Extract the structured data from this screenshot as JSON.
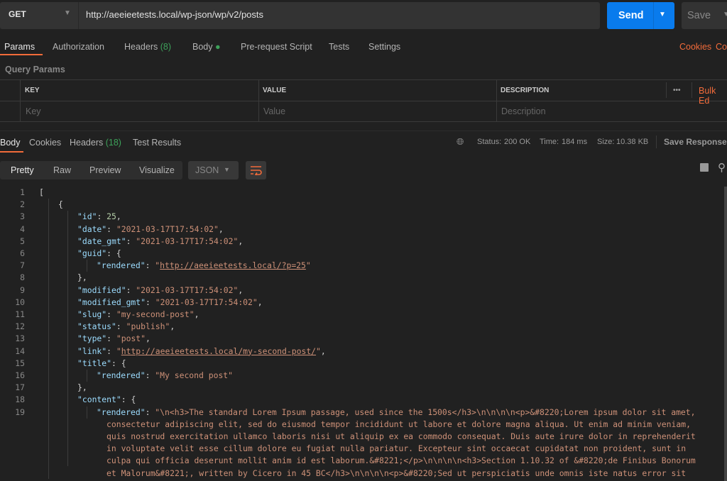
{
  "request": {
    "method": "GET",
    "url": "http://aeeieetests.local/wp-json/wp/v2/posts",
    "send_label": "Send",
    "save_label": "Save"
  },
  "req_tabs": {
    "params": "Params",
    "authorization": "Authorization",
    "headers": "Headers",
    "headers_count": "(8)",
    "body": "Body",
    "prerequest": "Pre-request Script",
    "tests": "Tests",
    "settings": "Settings",
    "cookies": "Cookies",
    "code": "Co"
  },
  "query_params": {
    "title": "Query Params",
    "headers": {
      "key": "KEY",
      "value": "VALUE",
      "description": "DESCRIPTION",
      "more": "•••",
      "bulk_edit": "Bulk Ed"
    },
    "placeholders": {
      "key": "Key",
      "value": "Value",
      "description": "Description"
    }
  },
  "response": {
    "tabs": {
      "body": "Body",
      "cookies": "Cookies",
      "headers": "Headers",
      "headers_count": "(18)",
      "test_results": "Test Results"
    },
    "status_label": "Status:",
    "status": "200 OK",
    "time_label": "Time:",
    "time": "184 ms",
    "size_label": "Size:",
    "size": "10.38 KB",
    "save_response": "Save Response",
    "views": {
      "pretty": "Pretty",
      "raw": "Raw",
      "preview": "Preview",
      "visualize": "Visualize",
      "format": "JSON"
    },
    "colors": {
      "accent": "#f26b3a",
      "send": "#097bed",
      "ok": "#3da15a"
    }
  },
  "code_lines": [
    {
      "n": "1",
      "i": 0,
      "t": [
        [
          "p",
          "["
        ]
      ]
    },
    {
      "n": "2",
      "i": 1,
      "t": [
        [
          "p",
          "{"
        ]
      ]
    },
    {
      "n": "3",
      "i": 2,
      "t": [
        [
          "k",
          "\"id\""
        ],
        [
          "p",
          ": "
        ],
        [
          "n",
          "25"
        ],
        [
          "p",
          ","
        ]
      ]
    },
    {
      "n": "4",
      "i": 2,
      "t": [
        [
          "k",
          "\"date\""
        ],
        [
          "p",
          ": "
        ],
        [
          "s",
          "\"2021-03-17T17:54:02\""
        ],
        [
          "p",
          ","
        ]
      ]
    },
    {
      "n": "5",
      "i": 2,
      "t": [
        [
          "k",
          "\"date_gmt\""
        ],
        [
          "p",
          ": "
        ],
        [
          "s",
          "\"2021-03-17T17:54:02\""
        ],
        [
          "p",
          ","
        ]
      ]
    },
    {
      "n": "6",
      "i": 2,
      "t": [
        [
          "k",
          "\"guid\""
        ],
        [
          "p",
          ": {"
        ]
      ]
    },
    {
      "n": "7",
      "i": 3,
      "t": [
        [
          "k",
          "\"rendered\""
        ],
        [
          "p",
          ": "
        ],
        [
          "s",
          "\""
        ],
        [
          "l",
          "http://aeeieetests.local/?p=25"
        ],
        [
          "s",
          "\""
        ]
      ]
    },
    {
      "n": "8",
      "i": 2,
      "t": [
        [
          "p",
          "},"
        ]
      ]
    },
    {
      "n": "9",
      "i": 2,
      "t": [
        [
          "k",
          "\"modified\""
        ],
        [
          "p",
          ": "
        ],
        [
          "s",
          "\"2021-03-17T17:54:02\""
        ],
        [
          "p",
          ","
        ]
      ]
    },
    {
      "n": "10",
      "i": 2,
      "t": [
        [
          "k",
          "\"modified_gmt\""
        ],
        [
          "p",
          ": "
        ],
        [
          "s",
          "\"2021-03-17T17:54:02\""
        ],
        [
          "p",
          ","
        ]
      ]
    },
    {
      "n": "11",
      "i": 2,
      "t": [
        [
          "k",
          "\"slug\""
        ],
        [
          "p",
          ": "
        ],
        [
          "s",
          "\"my-second-post\""
        ],
        [
          "p",
          ","
        ]
      ]
    },
    {
      "n": "12",
      "i": 2,
      "t": [
        [
          "k",
          "\"status\""
        ],
        [
          "p",
          ": "
        ],
        [
          "s",
          "\"publish\""
        ],
        [
          "p",
          ","
        ]
      ]
    },
    {
      "n": "13",
      "i": 2,
      "t": [
        [
          "k",
          "\"type\""
        ],
        [
          "p",
          ": "
        ],
        [
          "s",
          "\"post\""
        ],
        [
          "p",
          ","
        ]
      ]
    },
    {
      "n": "14",
      "i": 2,
      "t": [
        [
          "k",
          "\"link\""
        ],
        [
          "p",
          ": "
        ],
        [
          "s",
          "\""
        ],
        [
          "l",
          "http://aeeieetests.local/my-second-post/"
        ],
        [
          "s",
          "\""
        ],
        [
          "p",
          ","
        ]
      ]
    },
    {
      "n": "15",
      "i": 2,
      "t": [
        [
          "k",
          "\"title\""
        ],
        [
          "p",
          ": {"
        ]
      ]
    },
    {
      "n": "16",
      "i": 3,
      "t": [
        [
          "k",
          "\"rendered\""
        ],
        [
          "p",
          ": "
        ],
        [
          "s",
          "\"My second post\""
        ]
      ]
    },
    {
      "n": "17",
      "i": 2,
      "t": [
        [
          "p",
          "},"
        ]
      ]
    },
    {
      "n": "18",
      "i": 2,
      "t": [
        [
          "k",
          "\"content\""
        ],
        [
          "p",
          ": {"
        ]
      ]
    },
    {
      "n": "19",
      "i": 3,
      "t": [
        [
          "k",
          "\"rendered\""
        ],
        [
          "p",
          ": "
        ],
        [
          "s",
          "\"\\n<h3>The standard Lorem Ipsum passage, used since the 1500s</h3>\\n\\n\\n\\n<p>&#8220;Lorem ipsum dolor sit amet,"
        ]
      ]
    },
    {
      "n": "",
      "i": 4,
      "t": [
        [
          "s",
          "consectetur adipiscing elit, sed do eiusmod tempor incididunt ut labore et dolore magna aliqua. Ut enim ad minim veniam,"
        ]
      ]
    },
    {
      "n": "",
      "i": 4,
      "t": [
        [
          "s",
          "quis nostrud exercitation ullamco laboris nisi ut aliquip ex ea commodo consequat. Duis aute irure dolor in reprehenderit"
        ]
      ]
    },
    {
      "n": "",
      "i": 4,
      "t": [
        [
          "s",
          "in voluptate velit esse cillum dolore eu fugiat nulla pariatur. Excepteur sint occaecat cupidatat non proident, sunt in"
        ]
      ]
    },
    {
      "n": "",
      "i": 4,
      "t": [
        [
          "s",
          "culpa qui officia deserunt mollit anim id est laborum.&#8221;</p>\\n\\n\\n\\n<h3>Section 1.10.32 of &#8220;de Finibus Bonorum"
        ]
      ]
    },
    {
      "n": "",
      "i": 4,
      "t": [
        [
          "s",
          "et Malorum&#8221;, written by Cicero in 45 BC</h3>\\n\\n\\n\\n<p>&#8220;Sed ut perspiciatis unde omnis iste natus error sit"
        ]
      ]
    }
  ]
}
